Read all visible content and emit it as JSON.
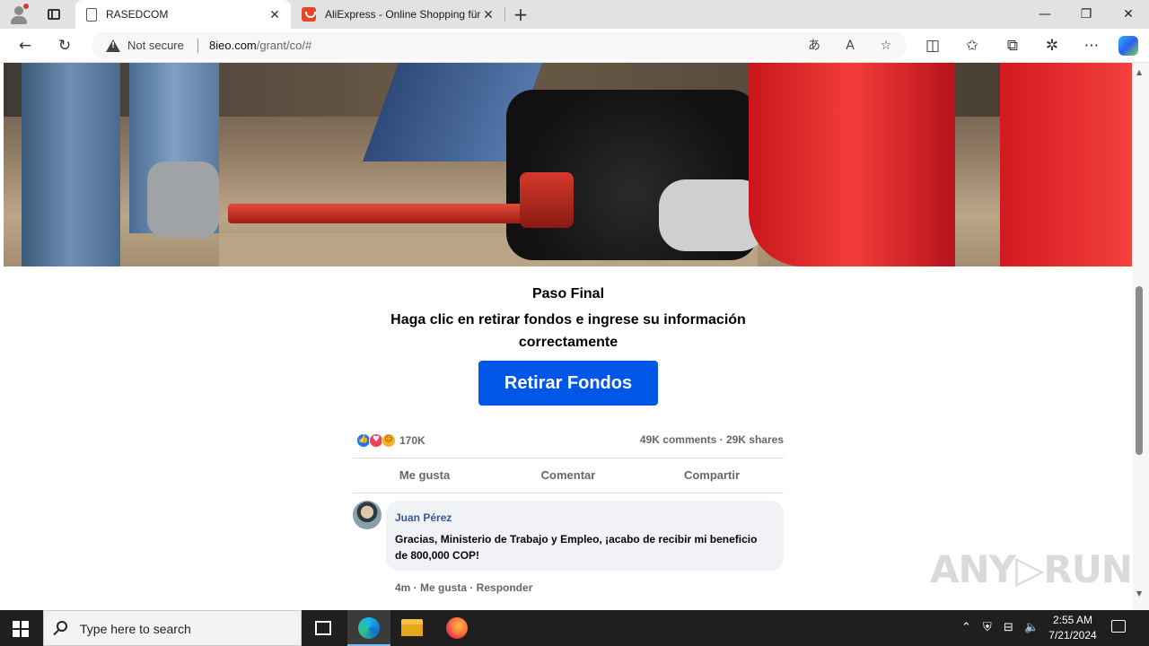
{
  "browser": {
    "tabs": [
      {
        "title": "RASEDCOM",
        "close": "✕"
      },
      {
        "title": "AliExpress - Online Shopping für",
        "close": "✕"
      }
    ],
    "new_tab": "+",
    "window_controls": {
      "minimize": "—",
      "maximize": "❐",
      "close": "✕"
    },
    "security_label": "Not secure",
    "url_host": "8ieo.com",
    "url_path": "/grant/co/#"
  },
  "page": {
    "step_title": "Paso Final",
    "instruction": "Haga clic en retirar fondos e ingrese su información correctamente",
    "cta_label": "Retirar Fondos",
    "reactions": {
      "icons": [
        "like-icon",
        "love-icon",
        "haha-icon"
      ],
      "count": "170K",
      "stats": "49K comments · 29K shares"
    },
    "actions": [
      "Me gusta",
      "Comentar",
      "Compartir"
    ],
    "comment": {
      "author": "Juan Pérez",
      "text": "Gracias, Ministerio de Trabajo y Empleo, ¡acabo de recibir mi beneficio de 800,000 COP!",
      "meta": "4m · Me gusta · Responder"
    },
    "watermark": "ANY▷RUN"
  },
  "taskbar": {
    "search_placeholder": "Type here to search",
    "time": "2:55 AM",
    "date": "7/21/2024"
  },
  "colors": {
    "cta_background": "#0057e7",
    "author_link": "#385898",
    "tab_strip": "#e2e2e2"
  }
}
